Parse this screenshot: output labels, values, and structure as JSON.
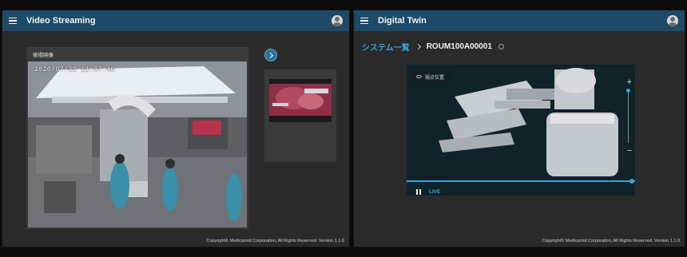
{
  "left_panel": {
    "title": "Video Streaming",
    "camera_label": "術場映像",
    "timestamp": "2020/07/22  11:37:46",
    "footer": "Copyright© Medicaroid Corporation, All Rights Reserved.   Version 1.1.0"
  },
  "right_panel": {
    "title": "Digital Twin",
    "breadcrumb_root": "システム一覧",
    "breadcrumb_current": "ROUM100A00001",
    "viewpoint_label": "視点位置",
    "live_label": "LIVE",
    "footer": "Copyright© Medicaroid Corporation, All Rights Reserved.   Version 1.1.0"
  },
  "colors": {
    "appbar": "#1e4a67",
    "accent": "#3ba3d8",
    "panel_bg": "#2a2a2b"
  },
  "icons": {
    "menu": "hamburger-menu-icon",
    "avatar": "user-avatar-icon",
    "next": "chevron-right-icon",
    "pause": "pause-icon",
    "info": "info-icon",
    "viewpoint": "eye-icon"
  }
}
